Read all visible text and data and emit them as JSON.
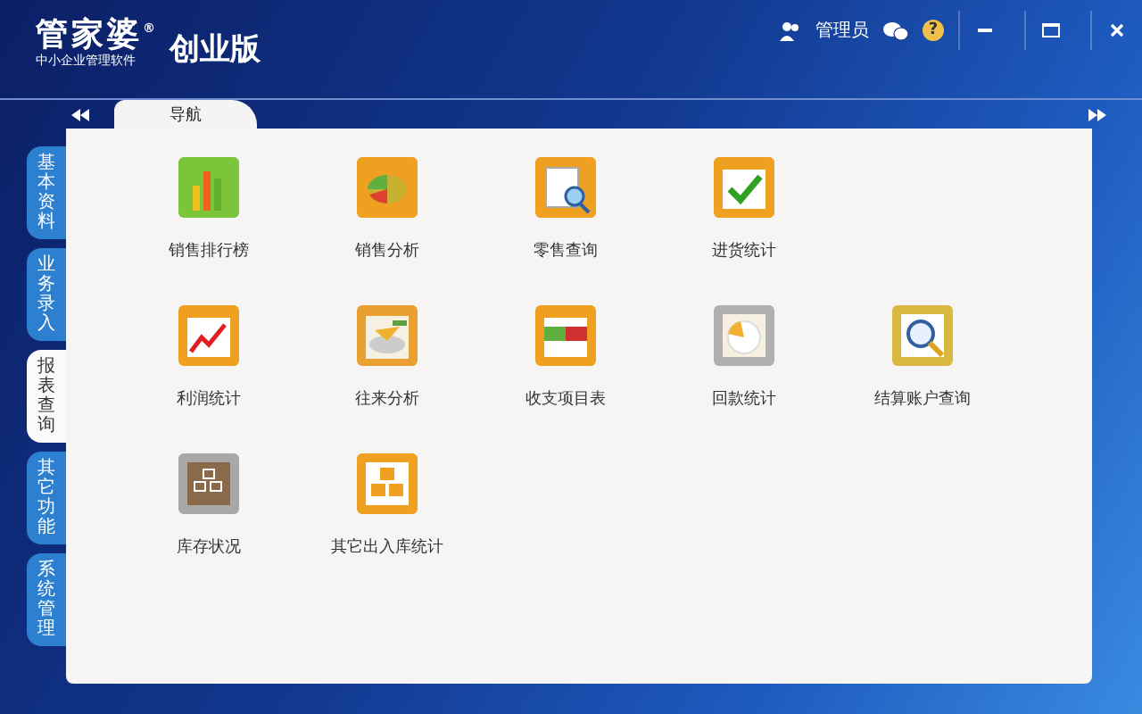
{
  "header": {
    "logo": "管家婆",
    "logo_mark": "®",
    "logo_sub": "中小企业管理软件",
    "edition": "创业版",
    "user": "管理员",
    "help": "?"
  },
  "nav_tab": {
    "label": "导航"
  },
  "side_tabs": [
    {
      "label": "基本资料",
      "selected": false
    },
    {
      "label": "业务录入",
      "selected": false
    },
    {
      "label": "报表查询",
      "selected": true
    },
    {
      "label": "其它功能",
      "selected": false
    },
    {
      "label": "系统管理",
      "selected": false
    }
  ],
  "rows": [
    [
      {
        "label": "销售排行榜"
      },
      {
        "label": "销售分析"
      },
      {
        "label": "零售查询"
      },
      {
        "label": "进货统计"
      }
    ],
    [
      {
        "label": "利润统计"
      },
      {
        "label": "往来分析"
      },
      {
        "label": "收支项目表"
      },
      {
        "label": "回款统计"
      },
      {
        "label": "结算账户查询"
      }
    ],
    [
      {
        "label": "库存状况"
      },
      {
        "label": "其它出入库统计"
      }
    ]
  ]
}
